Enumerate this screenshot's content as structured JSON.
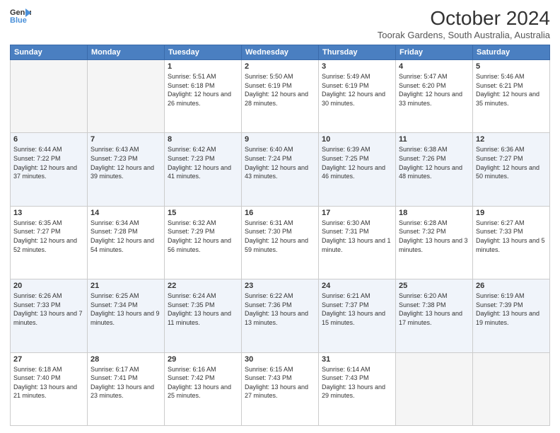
{
  "logo": {
    "line1": "General",
    "line2": "Blue"
  },
  "title": "October 2024",
  "subtitle": "Toorak Gardens, South Australia, Australia",
  "days_of_week": [
    "Sunday",
    "Monday",
    "Tuesday",
    "Wednesday",
    "Thursday",
    "Friday",
    "Saturday"
  ],
  "weeks": [
    [
      {
        "day": "",
        "info": ""
      },
      {
        "day": "",
        "info": ""
      },
      {
        "day": "1",
        "info": "Sunrise: 5:51 AM\nSunset: 6:18 PM\nDaylight: 12 hours and 26 minutes."
      },
      {
        "day": "2",
        "info": "Sunrise: 5:50 AM\nSunset: 6:19 PM\nDaylight: 12 hours and 28 minutes."
      },
      {
        "day": "3",
        "info": "Sunrise: 5:49 AM\nSunset: 6:19 PM\nDaylight: 12 hours and 30 minutes."
      },
      {
        "day": "4",
        "info": "Sunrise: 5:47 AM\nSunset: 6:20 PM\nDaylight: 12 hours and 33 minutes."
      },
      {
        "day": "5",
        "info": "Sunrise: 5:46 AM\nSunset: 6:21 PM\nDaylight: 12 hours and 35 minutes."
      }
    ],
    [
      {
        "day": "6",
        "info": "Sunrise: 6:44 AM\nSunset: 7:22 PM\nDaylight: 12 hours and 37 minutes."
      },
      {
        "day": "7",
        "info": "Sunrise: 6:43 AM\nSunset: 7:23 PM\nDaylight: 12 hours and 39 minutes."
      },
      {
        "day": "8",
        "info": "Sunrise: 6:42 AM\nSunset: 7:23 PM\nDaylight: 12 hours and 41 minutes."
      },
      {
        "day": "9",
        "info": "Sunrise: 6:40 AM\nSunset: 7:24 PM\nDaylight: 12 hours and 43 minutes."
      },
      {
        "day": "10",
        "info": "Sunrise: 6:39 AM\nSunset: 7:25 PM\nDaylight: 12 hours and 46 minutes."
      },
      {
        "day": "11",
        "info": "Sunrise: 6:38 AM\nSunset: 7:26 PM\nDaylight: 12 hours and 48 minutes."
      },
      {
        "day": "12",
        "info": "Sunrise: 6:36 AM\nSunset: 7:27 PM\nDaylight: 12 hours and 50 minutes."
      }
    ],
    [
      {
        "day": "13",
        "info": "Sunrise: 6:35 AM\nSunset: 7:27 PM\nDaylight: 12 hours and 52 minutes."
      },
      {
        "day": "14",
        "info": "Sunrise: 6:34 AM\nSunset: 7:28 PM\nDaylight: 12 hours and 54 minutes."
      },
      {
        "day": "15",
        "info": "Sunrise: 6:32 AM\nSunset: 7:29 PM\nDaylight: 12 hours and 56 minutes."
      },
      {
        "day": "16",
        "info": "Sunrise: 6:31 AM\nSunset: 7:30 PM\nDaylight: 12 hours and 59 minutes."
      },
      {
        "day": "17",
        "info": "Sunrise: 6:30 AM\nSunset: 7:31 PM\nDaylight: 13 hours and 1 minute."
      },
      {
        "day": "18",
        "info": "Sunrise: 6:28 AM\nSunset: 7:32 PM\nDaylight: 13 hours and 3 minutes."
      },
      {
        "day": "19",
        "info": "Sunrise: 6:27 AM\nSunset: 7:33 PM\nDaylight: 13 hours and 5 minutes."
      }
    ],
    [
      {
        "day": "20",
        "info": "Sunrise: 6:26 AM\nSunset: 7:33 PM\nDaylight: 13 hours and 7 minutes."
      },
      {
        "day": "21",
        "info": "Sunrise: 6:25 AM\nSunset: 7:34 PM\nDaylight: 13 hours and 9 minutes."
      },
      {
        "day": "22",
        "info": "Sunrise: 6:24 AM\nSunset: 7:35 PM\nDaylight: 13 hours and 11 minutes."
      },
      {
        "day": "23",
        "info": "Sunrise: 6:22 AM\nSunset: 7:36 PM\nDaylight: 13 hours and 13 minutes."
      },
      {
        "day": "24",
        "info": "Sunrise: 6:21 AM\nSunset: 7:37 PM\nDaylight: 13 hours and 15 minutes."
      },
      {
        "day": "25",
        "info": "Sunrise: 6:20 AM\nSunset: 7:38 PM\nDaylight: 13 hours and 17 minutes."
      },
      {
        "day": "26",
        "info": "Sunrise: 6:19 AM\nSunset: 7:39 PM\nDaylight: 13 hours and 19 minutes."
      }
    ],
    [
      {
        "day": "27",
        "info": "Sunrise: 6:18 AM\nSunset: 7:40 PM\nDaylight: 13 hours and 21 minutes."
      },
      {
        "day": "28",
        "info": "Sunrise: 6:17 AM\nSunset: 7:41 PM\nDaylight: 13 hours and 23 minutes."
      },
      {
        "day": "29",
        "info": "Sunrise: 6:16 AM\nSunset: 7:42 PM\nDaylight: 13 hours and 25 minutes."
      },
      {
        "day": "30",
        "info": "Sunrise: 6:15 AM\nSunset: 7:43 PM\nDaylight: 13 hours and 27 minutes."
      },
      {
        "day": "31",
        "info": "Sunrise: 6:14 AM\nSunset: 7:43 PM\nDaylight: 13 hours and 29 minutes."
      },
      {
        "day": "",
        "info": ""
      },
      {
        "day": "",
        "info": ""
      }
    ]
  ]
}
